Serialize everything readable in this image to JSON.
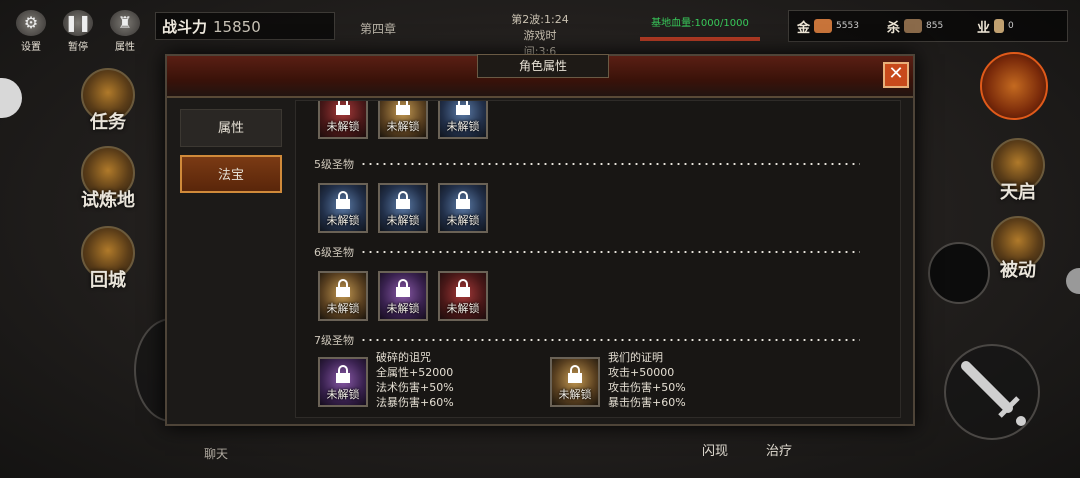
{
  "hud": {
    "buttons": [
      {
        "label": "设置",
        "icon": "gear-icon"
      },
      {
        "label": "暂停",
        "icon": "pause-icon"
      },
      {
        "label": "属性",
        "icon": "attributes-icon"
      }
    ],
    "power_label": "战斗力",
    "power_value": "15850",
    "chapter": "第四章",
    "wave": "第2波:1:24",
    "game_time": "游戏时间:3:6",
    "base_hp": "基地血量:1000/1000",
    "stats": [
      {
        "label": "金",
        "value": "5553",
        "icon": "gold-icon",
        "color": "#c8743a"
      },
      {
        "label": "杀",
        "value": "855",
        "icon": "skull-icon",
        "color": "#8a6a4a"
      },
      {
        "label": "业",
        "value": "0",
        "icon": "hourglass-icon",
        "color": "#c0a070"
      }
    ],
    "left_menu": [
      "任务",
      "试炼地",
      "回城"
    ],
    "right_menu": [
      "天启",
      "被动"
    ],
    "chat": "聊天",
    "skills": [
      "闪现",
      "治疗"
    ]
  },
  "dialog": {
    "title": "角色属性",
    "tabs": [
      "属性",
      "法宝"
    ],
    "active_tab": 1,
    "sections": [
      {
        "title": "5级圣物",
        "items": [
          {
            "color": "blue"
          },
          {
            "color": "blue"
          },
          {
            "color": "blue"
          }
        ]
      },
      {
        "title": "6级圣物",
        "items": [
          {
            "color": "gold"
          },
          {
            "color": "purple"
          },
          {
            "color": "red"
          }
        ]
      },
      {
        "title": "7级圣物"
      }
    ],
    "top_partial_items": [
      {
        "color": "red"
      },
      {
        "color": "gold"
      },
      {
        "color": "blue"
      }
    ],
    "locked_label": "未解锁",
    "relics": [
      {
        "name": "破碎的诅咒",
        "lines": [
          "全属性+52000",
          "法术伤害+50%",
          "法暴伤害+60%"
        ],
        "color": "purple"
      },
      {
        "name": "我们的证明",
        "lines": [
          "攻击+50000",
          "攻击伤害+50%",
          "暴击伤害+60%"
        ],
        "color": "gold"
      }
    ]
  }
}
